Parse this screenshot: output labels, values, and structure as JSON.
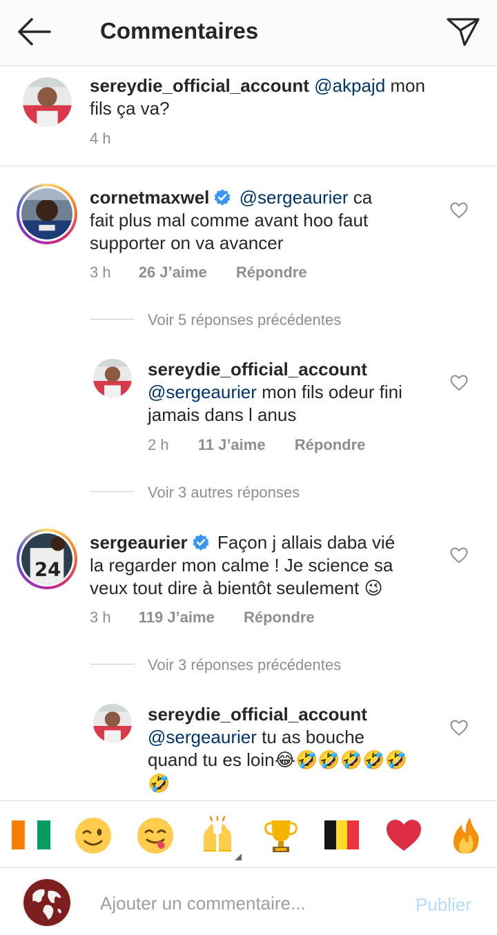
{
  "header": {
    "title": "Commentaires"
  },
  "top_comment": {
    "username": "sereydie_official_account",
    "mention": "@akpajd",
    "text_part1": " mon",
    "text_part2": "fils ça va?",
    "time": "4 h"
  },
  "comment1": {
    "username": "cornetmaxwel",
    "mention": "@sergeaurier",
    "text_part1": "  ca",
    "text_line2": "fait plus mal comme avant hoo faut",
    "text_line3": "supporter on va avancer",
    "time": "3 h",
    "likes": "26 J’aime",
    "reply": "Répondre",
    "view_replies": "Voir 5 réponses précédentes"
  },
  "reply1": {
    "username": "sereydie_official_account",
    "mention": "@sergeaurier",
    "text_part1": " mon fils odeur fini",
    "text_line2": "jamais dans l anus",
    "time": "2 h",
    "likes": "11 J’aime",
    "reply": "Répondre",
    "view_more": "Voir 3 autres réponses"
  },
  "comment2": {
    "username": "sergeaurier",
    "text_part1": "Façon j allais daba vié",
    "text_line2": "la regarder mon calme ! Je science sa",
    "text_line3": "veux tout dire à bientôt seulement ",
    "emoji": "😉",
    "time": "3 h",
    "likes": "119 J’aime",
    "reply": "Répondre",
    "view_replies": "Voir 3 réponses précédentes"
  },
  "reply2": {
    "username": "sereydie_official_account",
    "mention": "@sergeaurier",
    "text_part1": " tu as bouche",
    "text_line2": "quand tu es loin",
    "emojis_line2": "😂🤣🤣🤣🤣🤣",
    "emojis_line3": "🤣"
  },
  "emoji_bar": {
    "items": [
      "flag-ci-icon",
      "wink-emoji",
      "yum-emoji",
      "raised-hands-emoji",
      "trophy-emoji",
      "flag-be-icon",
      "heart-emoji",
      "fire-emoji"
    ]
  },
  "composer": {
    "placeholder": "Ajouter un commentaire...",
    "publish": "Publier"
  },
  "colors": {
    "mention": "#003569",
    "secondary": "#8e8e8e",
    "verified": "#3897f0",
    "publish": "#b3dbff"
  }
}
